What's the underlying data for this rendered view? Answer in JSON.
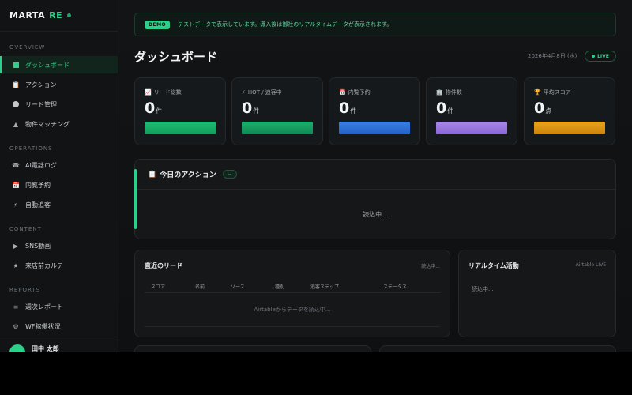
{
  "brand": {
    "name": "MARTA",
    "suffix": "RE"
  },
  "sidebar": {
    "sections": [
      {
        "title": "OVERVIEW",
        "items": [
          {
            "label": "ダッシュボード",
            "icon": "square-icon",
            "active": true
          },
          {
            "label": "アクション",
            "icon": "clipboard-icon"
          },
          {
            "label": "リード管理",
            "icon": "circle-icon"
          },
          {
            "label": "物件マッチング",
            "icon": "triangle-icon"
          }
        ]
      },
      {
        "title": "OPERATIONS",
        "items": [
          {
            "label": "AI電話ログ",
            "icon": "phone-icon"
          },
          {
            "label": "内覧予約",
            "icon": "calendar-icon"
          },
          {
            "label": "自動追客",
            "icon": "lightning-icon"
          }
        ]
      },
      {
        "title": "CONTENT",
        "items": [
          {
            "label": "SNS動画",
            "icon": "play-icon"
          },
          {
            "label": "来店前カルテ",
            "icon": "star-icon"
          }
        ]
      },
      {
        "title": "REPORTS",
        "items": [
          {
            "label": "週次レポート",
            "icon": "list-icon"
          },
          {
            "label": "WF稼働状況",
            "icon": "gear-icon"
          }
        ]
      }
    ],
    "user": {
      "name": "田中 太郎"
    }
  },
  "demo": {
    "badge": "DEMO",
    "text": "テストデータで表示しています。導入後は御社のリアルタイムデータが表示されます。"
  },
  "header": {
    "title": "ダッシュボード",
    "date": "2026年4月8日 (水)",
    "live": "LIVE"
  },
  "stats": [
    {
      "label": "リード総数",
      "value": "0",
      "unit": "件",
      "icon": "chart-icon",
      "color": "#17a866"
    },
    {
      "label": "HOT / 追客中",
      "value": "0",
      "unit": "件",
      "icon": "lightning-icon",
      "color": "#169a63"
    },
    {
      "label": "内覧予約",
      "value": "0",
      "unit": "件",
      "icon": "calendar-icon",
      "color": "#2c6fd6"
    },
    {
      "label": "物件数",
      "value": "0",
      "unit": "件",
      "icon": "building-icon",
      "color": "#9b77e0"
    },
    {
      "label": "平均スコア",
      "value": "0",
      "unit": "点",
      "icon": "trophy-icon",
      "color": "#de9412"
    }
  ],
  "actions": {
    "title": "今日のアクション",
    "count": "--",
    "loading": "読込中..."
  },
  "leads": {
    "title": "直近のリード",
    "status": "読込中...",
    "columns": [
      "スコア",
      "名前",
      "ソース",
      "種別",
      "追客ステップ",
      "ステータス"
    ],
    "message": "Airtableからデータを読込中..."
  },
  "realtime": {
    "title": "リアルタイム活動",
    "source": "Airtable LIVE",
    "loading": "読込中..."
  },
  "colors": {
    "accent": "#2dd08a",
    "background": "#0d0f11"
  }
}
